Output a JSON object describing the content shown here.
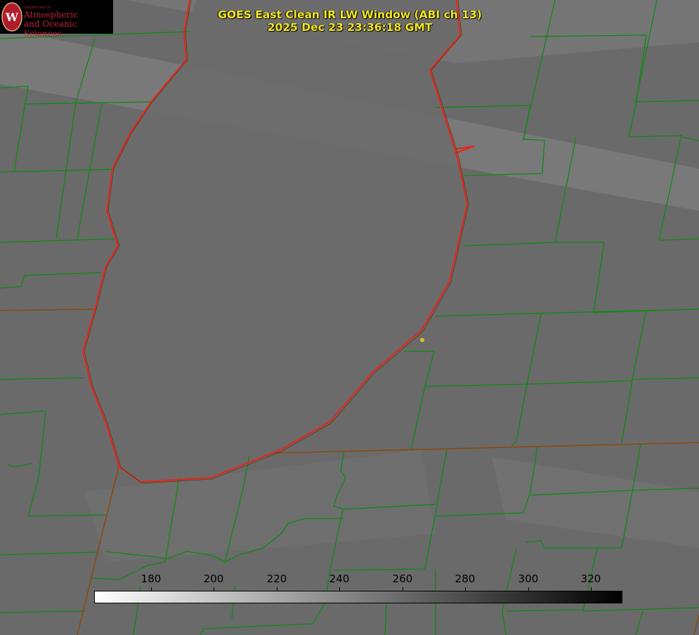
{
  "logo": {
    "department": "Department of",
    "line1": "Atmospheric",
    "line2": "and Oceanic Sciences",
    "badge_letter": "W"
  },
  "title": {
    "line1": "GOES East Clean IR LW Window (ABI ch 13)",
    "line2": "2025 Dec 23 23:36:18 GMT"
  },
  "colorbar": {
    "ticks": [
      "180",
      "200",
      "220",
      "240",
      "260",
      "280",
      "300",
      "320"
    ],
    "min": 163,
    "max": 331,
    "gradient": [
      "#ffffff",
      "#000000"
    ]
  },
  "colors": {
    "lake_outline": "#e8231c",
    "county_lines": "#0f8a14",
    "state_lines": "#8a4a10",
    "title_text": "#f3e61c",
    "marker": "#d7c52a"
  }
}
